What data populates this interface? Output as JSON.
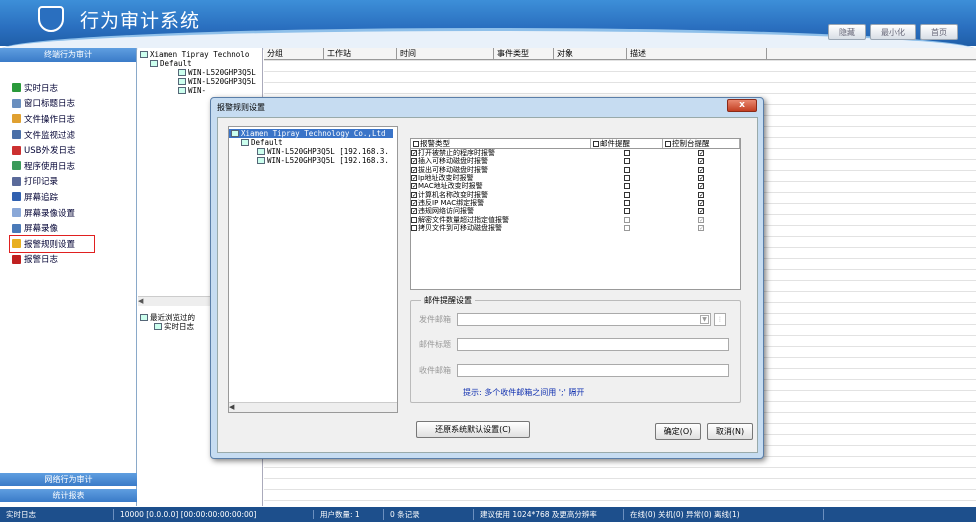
{
  "app": {
    "title": "行为审计系统"
  },
  "window_buttons": [
    "隐藏",
    "最小化",
    "首页"
  ],
  "sidebar": {
    "header": "终端行为审计",
    "items": [
      {
        "label": "实时日志",
        "icon": "chart-icon",
        "color": "#2a9a3a"
      },
      {
        "label": "窗口标题日志",
        "icon": "window-icon",
        "color": "#6a8fbf"
      },
      {
        "label": "文件操作日志",
        "icon": "file-icon",
        "color": "#e0a030"
      },
      {
        "label": "文件监视过滤",
        "icon": "filter-icon",
        "color": "#4a6fa8"
      },
      {
        "label": "USB外发日志",
        "icon": "usb-icon",
        "color": "#cc3030"
      },
      {
        "label": "程序使用日志",
        "icon": "program-icon",
        "color": "#3a9a5a"
      },
      {
        "label": "打印记录",
        "icon": "printer-icon",
        "color": "#5a6a9a"
      },
      {
        "label": "屏幕追踪",
        "icon": "monitor-icon",
        "color": "#3060b0"
      },
      {
        "label": "屏幕录像设置",
        "icon": "record-settings-icon",
        "color": "#8aa8d8"
      },
      {
        "label": "屏幕录像",
        "icon": "video-icon",
        "color": "#4a7ab8"
      },
      {
        "label": "报警规则设置",
        "icon": "warning-icon",
        "color": "#e8b020"
      },
      {
        "label": "报警日志",
        "icon": "alarm-log-icon",
        "color": "#c02020"
      }
    ],
    "footer": [
      "网络行为审计",
      "统计报表"
    ]
  },
  "tree": {
    "root": "Xiamen Tipray Technolo",
    "group": "Default",
    "nodes": [
      "WIN-L520GHP3Q5L",
      "WIN-L520GHP3Q5L",
      "WIN-"
    ]
  },
  "recent": {
    "root": "最近浏览过的",
    "child": "实时日志"
  },
  "grid": {
    "columns": [
      "分组",
      "工作站",
      "时间",
      "事件类型",
      "对象",
      "描述"
    ]
  },
  "dialog": {
    "title": "报警规则设置",
    "close": "x",
    "tree": {
      "root": "Xiamen Tipray Technology Co.,Ltd",
      "group": "Default",
      "nodes": [
        "WIN-L520GHP3Q5L [192.168.3.",
        "WIN-L520GHP3Q5L [192.168.3."
      ]
    },
    "table": {
      "headers": [
        "报警类型",
        "邮件提醒",
        "控制台提醒"
      ],
      "rows": [
        {
          "label": "打开被禁止的程序时报警",
          "on": true,
          "mail": false,
          "console": true,
          "disabled": false
        },
        {
          "label": "插入可移动磁盘时报警",
          "on": true,
          "mail": false,
          "console": true,
          "disabled": false
        },
        {
          "label": "拔出可移动磁盘时报警",
          "on": true,
          "mail": false,
          "console": true,
          "disabled": false
        },
        {
          "label": "Ip地址改变时报警",
          "on": true,
          "mail": false,
          "console": true,
          "disabled": false
        },
        {
          "label": "MAC地址改变时报警",
          "on": true,
          "mail": false,
          "console": true,
          "disabled": false
        },
        {
          "label": "计算机名称改变时报警",
          "on": true,
          "mail": false,
          "console": true,
          "disabled": false
        },
        {
          "label": "违反IP MAC绑定报警",
          "on": true,
          "mail": false,
          "console": true,
          "disabled": false
        },
        {
          "label": "违规网络访问报警",
          "on": true,
          "mail": false,
          "console": true,
          "disabled": false
        },
        {
          "label": "解密文件数量超过指定值报警",
          "on": false,
          "mail": false,
          "console": true,
          "disabled": true
        },
        {
          "label": "拷贝文件到可移动磁盘报警",
          "on": false,
          "mail": false,
          "console": true,
          "disabled": true
        }
      ]
    },
    "mail_settings": {
      "legend": "邮件提醒设置",
      "sender": "发件邮箱",
      "subject": "邮件标题",
      "receiver": "收件邮箱",
      "hint": "提示: 多个收件邮箱之间用 ';' 隔开"
    },
    "buttons": {
      "restore": "还原系统默认设置(C)",
      "ok": "确定(O)",
      "cancel": "取消(N)"
    }
  },
  "statusbar": [
    "实时日志",
    "10000 [0.0.0.0] [00:00:00:00:00:00]",
    "用户数量: 1",
    "0 条记录",
    "建议使用 1024*768 及更高分辨率",
    "在线(0) 关机(0) 异常(0) 离线(1)"
  ]
}
